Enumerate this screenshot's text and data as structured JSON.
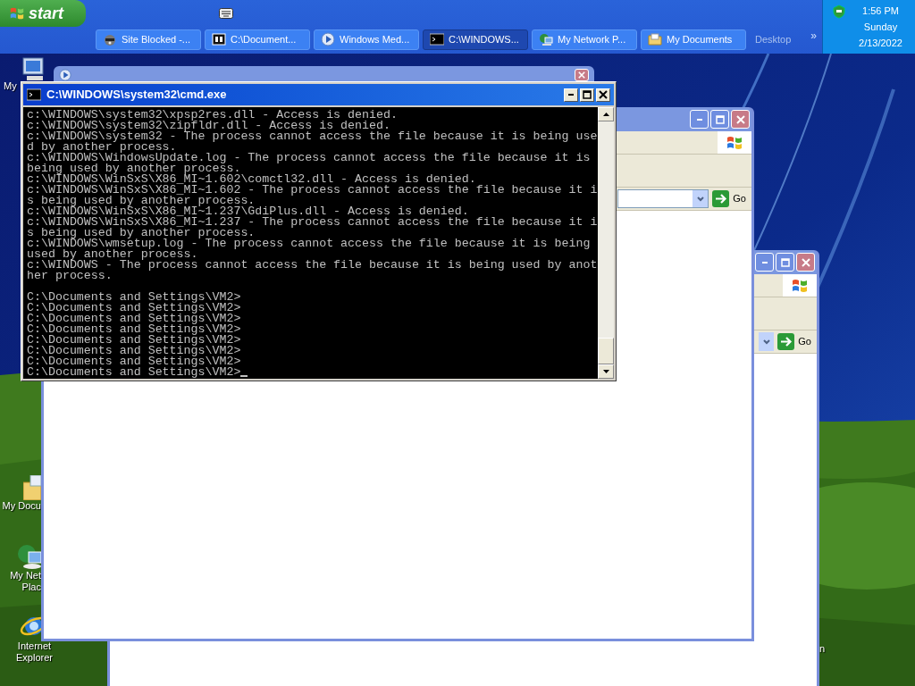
{
  "taskbar": {
    "start": "start",
    "tasks": [
      {
        "label": "Site Blocked -...",
        "kind": "shield",
        "selected": false
      },
      {
        "label": "C:\\Document...",
        "kind": "archive",
        "selected": false
      },
      {
        "label": "Windows Med...",
        "kind": "media",
        "selected": false
      },
      {
        "label": "C:\\WINDOWS...",
        "kind": "console",
        "selected": true
      },
      {
        "label": "My Network P...",
        "kind": "network",
        "selected": false
      },
      {
        "label": "My Documents",
        "kind": "folder",
        "selected": false
      }
    ],
    "desktop_toolbar": "Desktop",
    "more": "»",
    "tray": {
      "time": "1:56 PM",
      "day": "Sunday",
      "date": "2/13/2022"
    }
  },
  "desktop_icons": [
    {
      "kind": "computer",
      "lines": [
        "My"
      ]
    },
    {
      "kind": "folder",
      "lines": [
        "My Docu"
      ]
    },
    {
      "kind": "network",
      "lines": [
        "My Net",
        "Plac"
      ]
    },
    {
      "kind": "browser",
      "lines": [
        "Internet",
        "Explorer"
      ]
    },
    {
      "kind": "partial",
      "lines": [
        "n"
      ]
    }
  ],
  "explorer_windows": [
    {
      "go": "Go"
    },
    {
      "go": "Go"
    }
  ],
  "console": {
    "title": "C:\\WINDOWS\\system32\\cmd.exe",
    "output": [
      "c:\\WINDOWS\\system32\\xpsp2res.dll - Access is denied.",
      "c:\\WINDOWS\\system32\\zipfldr.dll - Access is denied.",
      "c:\\WINDOWS\\system32 - The process cannot access the file because it is being use",
      "d by another process.",
      "c:\\WINDOWS\\WindowsUpdate.log - The process cannot access the file because it is",
      "being used by another process.",
      "c:\\WINDOWS\\WinSxS\\X86_MI~1.602\\comctl32.dll - Access is denied.",
      "c:\\WINDOWS\\WinSxS\\X86_MI~1.602 - The process cannot access the file because it i",
      "s being used by another process.",
      "c:\\WINDOWS\\WinSxS\\X86_MI~1.237\\GdiPlus.dll - Access is denied.",
      "c:\\WINDOWS\\WinSxS\\X86_MI~1.237 - The process cannot access the file because it i",
      "s being used by another process.",
      "c:\\WINDOWS\\wmsetup.log - The process cannot access the file because it is being",
      "used by another process.",
      "c:\\WINDOWS - The process cannot access the file because it is being used by anot",
      "her process."
    ],
    "prompts": [
      "C:\\Documents and Settings\\VM2>",
      "C:\\Documents and Settings\\VM2>",
      "C:\\Documents and Settings\\VM2>",
      "C:\\Documents and Settings\\VM2>",
      "C:\\Documents and Settings\\VM2>",
      "C:\\Documents and Settings\\VM2>",
      "C:\\Documents and Settings\\VM2>",
      "C:\\Documents and Settings\\VM2>"
    ]
  }
}
